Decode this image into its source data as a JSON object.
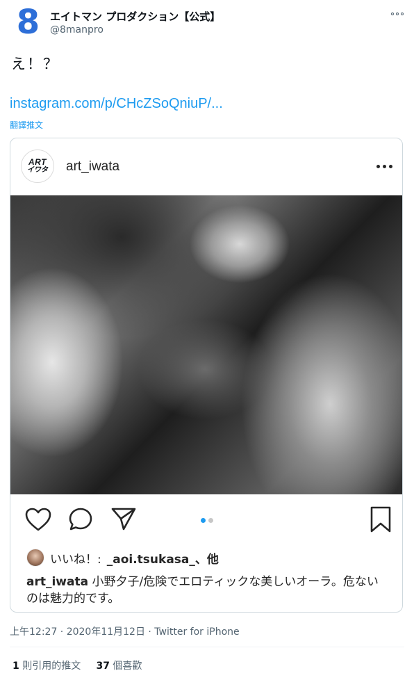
{
  "tweet": {
    "avatar_glyph": "8",
    "display_name": "エイトマン プロダクション【公式】",
    "handle": "@8manpro",
    "text": "え！？",
    "link": "instagram.com/p/CHcZSoQniuP/...",
    "translate_label": "翻譯推文",
    "timestamp": "上午12:27 · 2020年11月12日 · Twitter for iPhone",
    "stats": {
      "quotes_count": "1",
      "quotes_label": "則引用的推文",
      "likes_count": "37",
      "likes_label": "個喜歡"
    }
  },
  "embed": {
    "avatar_text_line1": "ART",
    "avatar_text_line2": "イワタ",
    "username": "art_iwata",
    "likes_prefix": "いいね！:",
    "likes_user": "_aoi.tsukasa_",
    "likes_suffix": "、他",
    "caption_user": "art_iwata",
    "caption_text": "小野夕子/危険でエロティックな美しいオーラ。危ないのは魅力的です。"
  },
  "colors": {
    "accent": "#1d9bf0",
    "logo_blue": "#2e6fd8",
    "secondary_text": "#536471"
  }
}
